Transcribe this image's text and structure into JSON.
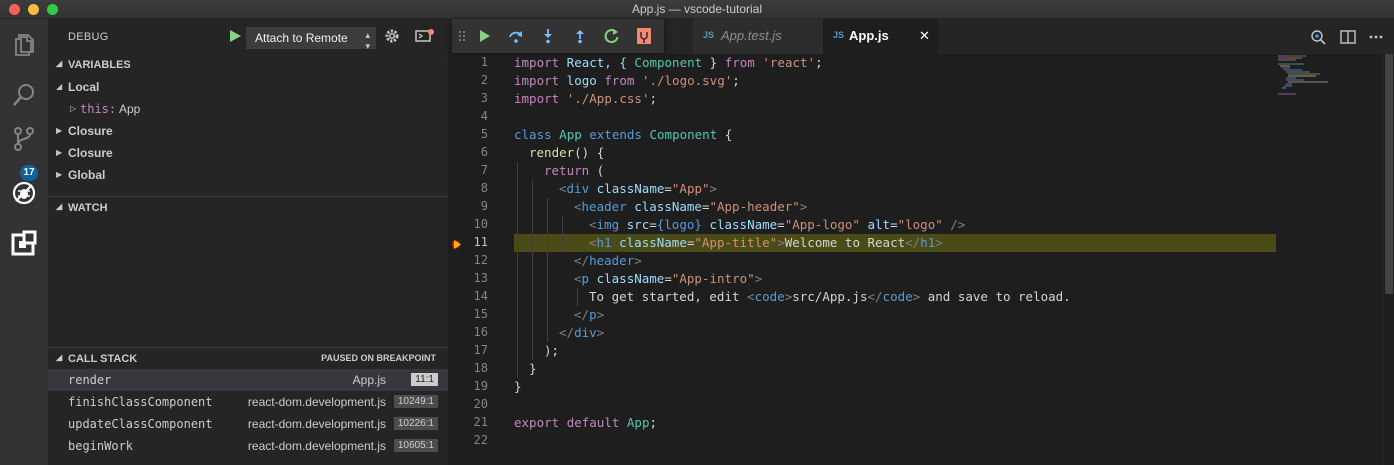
{
  "window": {
    "title": "App.js — vscode-tutorial"
  },
  "activity": {
    "scm_badge": "17"
  },
  "debug": {
    "title": "DEBUG",
    "config": "Attach to Remote"
  },
  "variables": {
    "title": "VARIABLES",
    "local_label": "Local",
    "this_key": "this:",
    "this_value": "App",
    "scopes": [
      "Closure",
      "Closure",
      "Global"
    ]
  },
  "watch": {
    "title": "WATCH"
  },
  "call_stack": {
    "title": "CALL STACK",
    "status": "PAUSED ON BREAKPOINT",
    "frames": [
      {
        "fn": "render",
        "file": "App.js",
        "pos": "11:1"
      },
      {
        "fn": "finishClassComponent",
        "file": "react-dom.development.js",
        "pos": "10249:1"
      },
      {
        "fn": "updateClassComponent",
        "file": "react-dom.development.js",
        "pos": "10226:1"
      },
      {
        "fn": "beginWork",
        "file": "react-dom.development.js",
        "pos": "10605:1"
      }
    ]
  },
  "tabs": [
    {
      "icon": "JS",
      "label": "App.test.js"
    },
    {
      "icon": "JS",
      "label": "App.js"
    }
  ],
  "editor": {
    "current_line": 11,
    "line_numbers": [
      "1",
      "2",
      "3",
      "4",
      "5",
      "6",
      "7",
      "8",
      "9",
      "10",
      "11",
      "12",
      "13",
      "14",
      "15",
      "16",
      "17",
      "18",
      "19",
      "20",
      "21",
      "22"
    ]
  },
  "code": {
    "l1": [
      "import",
      " React, { ",
      "Component",
      " } ",
      "from",
      " ",
      "'react'",
      ";"
    ],
    "l2": [
      "import",
      " logo ",
      "from",
      " ",
      "'./logo.svg'",
      ";"
    ],
    "l3": [
      "import",
      " ",
      "'./App.css'",
      ";"
    ],
    "l5": [
      "class",
      " ",
      "App",
      " ",
      "extends",
      " ",
      "Component",
      " {"
    ],
    "l6": [
      "render",
      "() {"
    ],
    "l7": [
      "return",
      " ("
    ],
    "l8": [
      "<",
      "div",
      " ",
      "className",
      "=",
      "\"App\"",
      ">"
    ],
    "l9": [
      "<",
      "header",
      " ",
      "className",
      "=",
      "\"App-header\"",
      ">"
    ],
    "l10": [
      "<",
      "img",
      " ",
      "src",
      "=",
      "{logo}",
      " ",
      "className",
      "=",
      "\"App-logo\"",
      " ",
      "alt",
      "=",
      "\"logo\"",
      " />"
    ],
    "l11": [
      "<",
      "h1",
      " ",
      "className",
      "=",
      "\"App-title\"",
      ">",
      "Welcome to React",
      "</",
      "h1",
      ">"
    ],
    "l12": [
      "</",
      "header",
      ">"
    ],
    "l13": [
      "<",
      "p",
      " ",
      "className",
      "=",
      "\"App-intro\"",
      ">"
    ],
    "l14": [
      "To get started, edit ",
      "<",
      "code",
      ">",
      "src/App.js",
      "</",
      "code",
      ">",
      " and save to reload."
    ],
    "l15": [
      "</",
      "p",
      ">"
    ],
    "l16": [
      "</",
      "div",
      ">"
    ],
    "l17": [
      ");"
    ],
    "l18": [
      "}"
    ],
    "l19": [
      "}"
    ],
    "l21": [
      "export",
      " ",
      "default",
      " ",
      "App",
      ";"
    ]
  }
}
